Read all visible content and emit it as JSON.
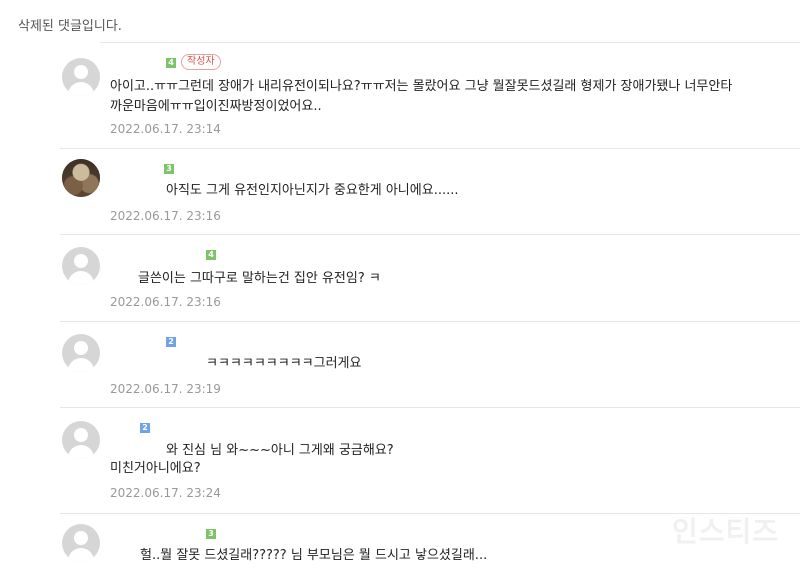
{
  "header": {
    "deleted_notice": "삭제된 댓글입니다."
  },
  "comments": [
    {
      "level": "4",
      "author_badge": "작성자",
      "lines": [
        "아이고..ㅠㅠ그런데 장애가 내리유전이되나요?ㅠㅠ저는 몰랐어요 그냥 뭘잘못드셨길래 형제가 장애가됐나 너무안타",
        "까운마음에ㅠㅠ입이진짜방정이었어요.."
      ],
      "date": "2022.06.17. 23:14"
    },
    {
      "level": "3",
      "lines": [
        "아직도 그게 유전인지아닌지가 중요한게 아니에요......"
      ],
      "date": "2022.06.17. 23:16"
    },
    {
      "level": "4",
      "lines": [
        "글쓴이는 그따구로 말하는건 집안 유전임? ㅋ"
      ],
      "date": "2022.06.17. 23:16"
    },
    {
      "level": "2",
      "lines": [
        "ㅋㅋㅋㅋㅋㅋㅋㅋㅋ그러게요"
      ],
      "date": "2022.06.17. 23:19"
    },
    {
      "level": "2",
      "lines": [
        "와 진심 님 와~~~아니 그게왜 궁금해요?",
        "미친거아니에요?"
      ],
      "date": "2022.06.17. 23:24"
    },
    {
      "level": "3",
      "lines": [
        "헐..뭘 잘못 드셨길래????? 님 부모님은 뭘 드시고 낳으셨길래..."
      ]
    }
  ],
  "watermark": "인스티즈"
}
